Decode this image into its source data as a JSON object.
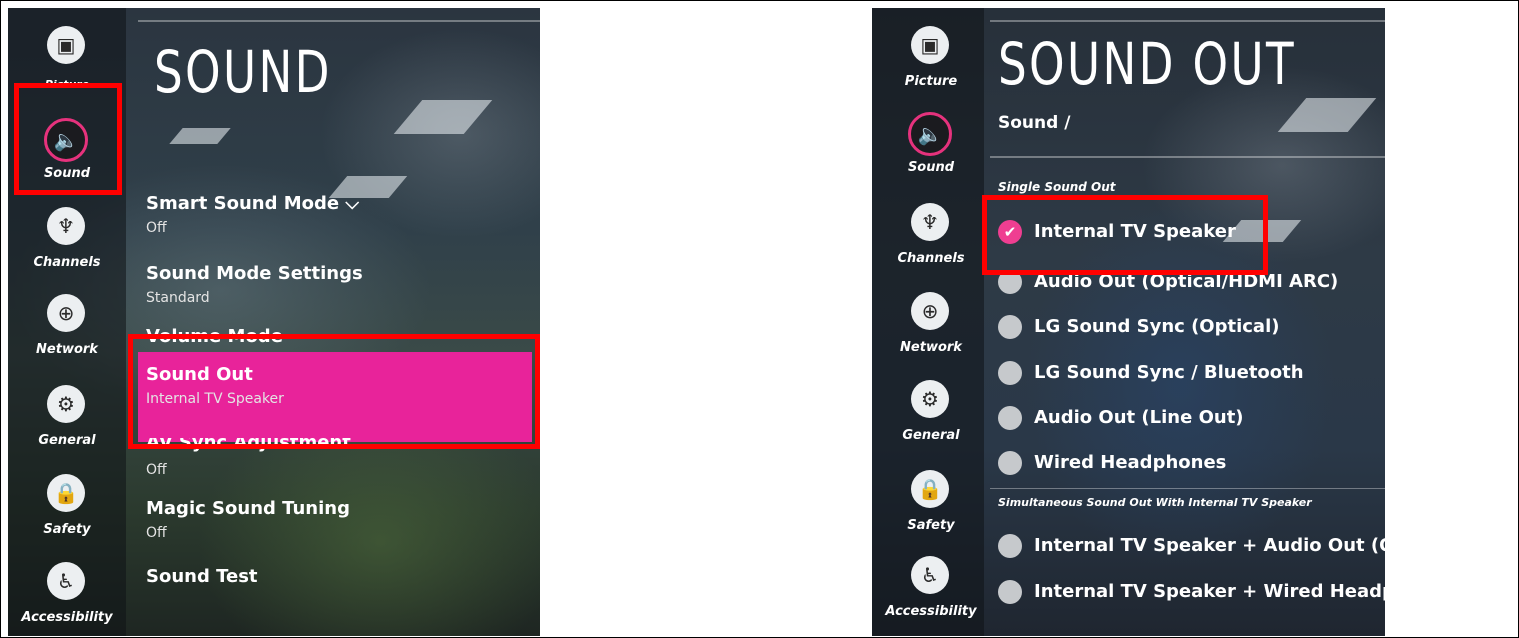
{
  "rail_items": [
    {
      "label": "Picture",
      "icon": "picture-icon"
    },
    {
      "label": "Sound",
      "icon": "speaker-icon"
    },
    {
      "label": "Channels",
      "icon": "satellite-dish-icon"
    },
    {
      "label": "Network",
      "icon": "globe-icon"
    },
    {
      "label": "General",
      "icon": "tools-icon"
    },
    {
      "label": "Safety",
      "icon": "lock-icon"
    },
    {
      "label": "Accessibility",
      "icon": "accessibility-icon"
    }
  ],
  "left_screen": {
    "title": "SOUND",
    "items": [
      {
        "name": "Smart Sound Mode ⌵",
        "value": "Off"
      },
      {
        "name": "Sound Mode Settings",
        "value": "Standard"
      },
      {
        "name": "Volume Mode",
        "value": ""
      },
      {
        "name": "Sound Out",
        "value": "Internal TV Speaker"
      },
      {
        "name": "AV Sync Adjustment",
        "value": "Off"
      },
      {
        "name": "Magic Sound Tuning",
        "value": "Off"
      },
      {
        "name": "Sound Test",
        "value": ""
      }
    ]
  },
  "right_screen": {
    "title": "SOUND OUT",
    "breadcrumb": "Sound /",
    "section1": "Single Sound Out",
    "options1": [
      {
        "label": "Internal TV Speaker",
        "selected": true
      },
      {
        "label": "Audio Out (Optical/HDMI ARC)",
        "selected": false
      },
      {
        "label": "LG Sound Sync (Optical)",
        "selected": false
      },
      {
        "label": "LG Sound Sync / Bluetooth",
        "selected": false
      },
      {
        "label": "Audio Out (Line Out)",
        "selected": false
      },
      {
        "label": "Wired Headphones",
        "selected": false
      }
    ],
    "section2": "Simultaneous Sound Out With Internal TV Speaker",
    "options2": [
      {
        "label": "Internal TV Speaker + Audio Out (Opt",
        "selected": false
      },
      {
        "label": "Internal TV Speaker + Wired Headpho",
        "selected": false
      }
    ]
  },
  "colors": {
    "highlight": "#e8239a",
    "annotation": "#ff0000",
    "accent": "#e6327d"
  }
}
